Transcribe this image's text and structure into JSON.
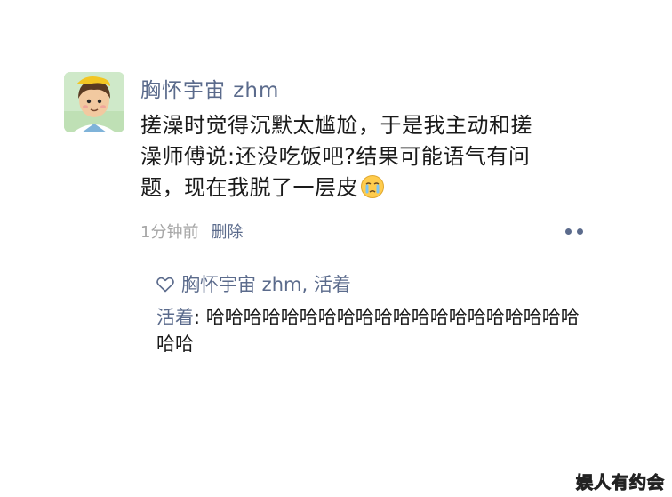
{
  "post": {
    "username": "胸怀宇宙 zhm",
    "content_lines": [
      "搓澡时觉得沉默太尴尬，于是我主动和搓",
      "澡师傅说:还没吃饭吧?结果可能语气有问",
      "题，现在我脱了一层皮"
    ],
    "content_emoji": "crying-emoji",
    "timestamp": "1分钟前",
    "delete_label": "删除",
    "more_icon": "more-dots-icon"
  },
  "interactions": {
    "like_icon": "heart-icon",
    "likers": "胸怀宇宙 zhm, 活着",
    "comment": {
      "author": "活着",
      "separator": ": ",
      "text_lines": [
        "哈哈哈哈哈哈哈哈哈哈哈哈哈哈哈哈哈哈哈哈",
        "哈哈"
      ]
    }
  },
  "watermark": "娱人有约会",
  "colors": {
    "link": "#5b6b8c",
    "text": "#1a1a1a",
    "muted": "#a6a6a6",
    "background": "#ffffff"
  }
}
